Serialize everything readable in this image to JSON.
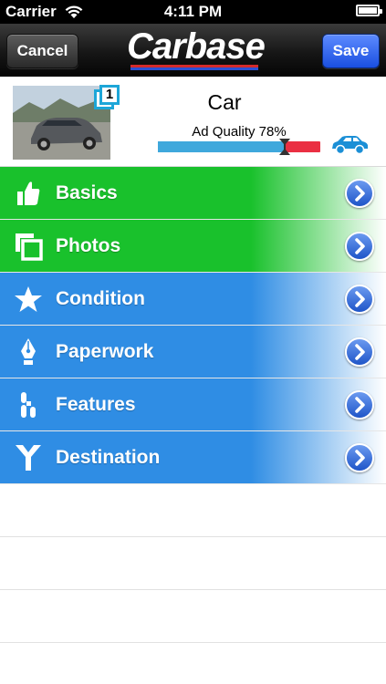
{
  "status_bar": {
    "carrier": "Carrier",
    "time": "4:11 PM"
  },
  "nav": {
    "cancel_label": "Cancel",
    "save_label": "Save",
    "logo_text": "Carbase"
  },
  "car": {
    "title": "Car",
    "photo_count": "1",
    "quality_label": "Ad Quality 78%",
    "quality_percent": 78
  },
  "menu": {
    "items": [
      {
        "label": "Basics",
        "icon": "thumbs-up-icon",
        "color": "#19c12c"
      },
      {
        "label": "Photos",
        "icon": "photos-icon",
        "color": "#19c12c"
      },
      {
        "label": "Condition",
        "icon": "star-icon",
        "color": "#2f8de4"
      },
      {
        "label": "Paperwork",
        "icon": "pen-nib-icon",
        "color": "#2f8de4"
      },
      {
        "label": "Features",
        "icon": "features-icon",
        "color": "#2f8de4"
      },
      {
        "label": "Destination",
        "icon": "fork-icon",
        "color": "#2f8de4"
      }
    ]
  },
  "colors": {
    "green": "#19c12c",
    "blue": "#2f8de4",
    "quality_blue": "#3fa8dc",
    "quality_red": "#ea2f42",
    "save_button": "#1a4fe0"
  }
}
